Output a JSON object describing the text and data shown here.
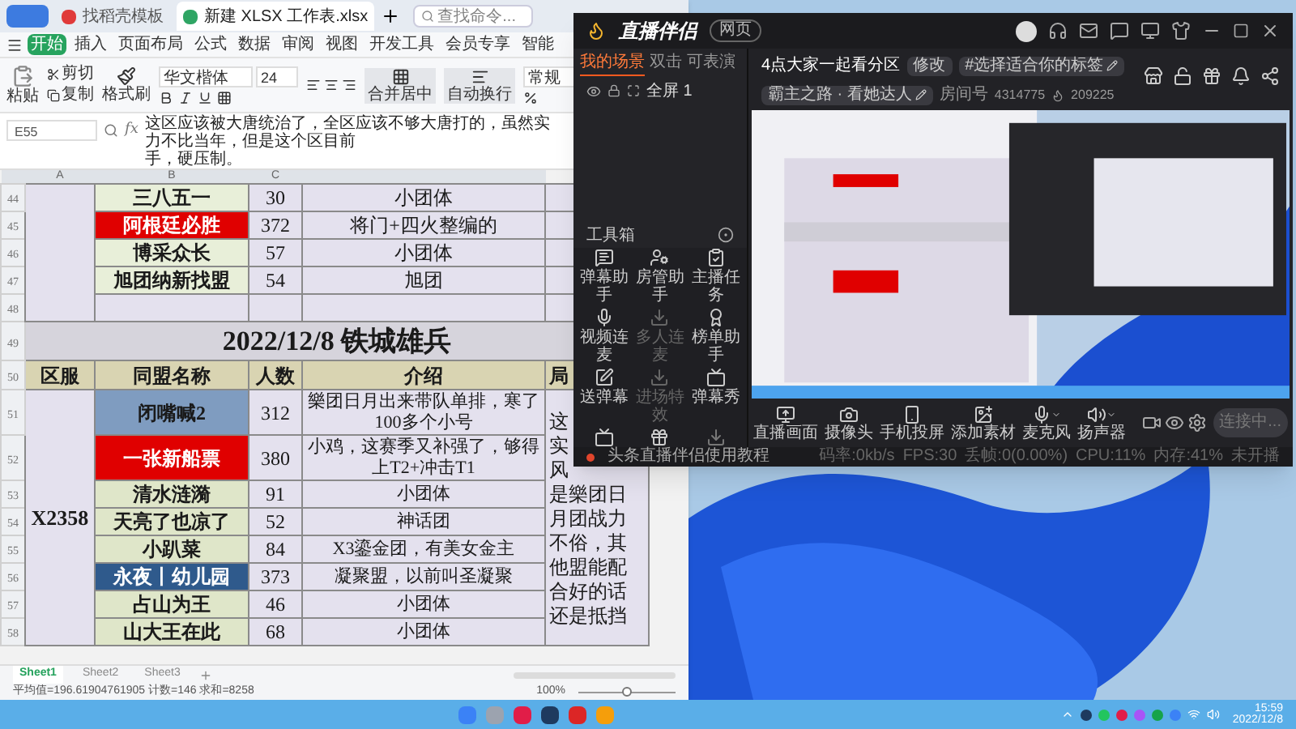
{
  "spreadsheet": {
    "tabs": [
      {
        "label": "找稻壳模板",
        "selected": false
      },
      {
        "label": "新建 XLSX 工作表.xlsx",
        "selected": true
      }
    ],
    "search": {
      "placeholder": "查找命令..."
    },
    "menu": [
      {
        "label": "开始",
        "selected": true
      },
      {
        "label": "插入",
        "selected": false
      },
      {
        "label": "页面布局",
        "selected": false
      },
      {
        "label": "公式",
        "selected": false
      },
      {
        "label": "数据",
        "selected": false
      },
      {
        "label": "审阅",
        "selected": false
      },
      {
        "label": "视图",
        "selected": false
      },
      {
        "label": "开发工具",
        "selected": false
      },
      {
        "label": "会员专享",
        "selected": false
      },
      {
        "label": "智能",
        "selected": false
      }
    ],
    "toolbar": {
      "paste": "粘贴",
      "cut": "剪切",
      "copy": "复制",
      "format_painter": "格式刷",
      "font": "华文楷体",
      "size": "24",
      "merge": "合并居中",
      "wrap": "自动换行",
      "number_format": "常规"
    },
    "cell_ref": "E55",
    "function_label": "fx",
    "formula_lines": [
      "这区应该被大唐统治了，全区应该不够大唐打的，虽然实力不比当年，但是这个区目前",
      "手，硬压制。"
    ],
    "column_headers": [
      "A",
      "B",
      "C"
    ],
    "top_rows": [
      {
        "row": "44",
        "name": "三八五一",
        "color": "#e8efd9",
        "count": "30",
        "intro": "小团体"
      },
      {
        "row": "45",
        "name": "阿根廷必胜",
        "color": "#e00000",
        "count": "372",
        "intro": "将门+四火整编的"
      },
      {
        "row": "46",
        "name": "博采众长",
        "color": "#e8efd9",
        "count": "57",
        "intro": "小团体"
      },
      {
        "row": "47",
        "name": "旭团纳新找盟",
        "color": "#e8efd9",
        "count": "54",
        "intro": "旭团"
      }
    ],
    "blank_row": "48",
    "title_row": {
      "row": "49",
      "title": "2022/12/8 铁城雄兵"
    },
    "header_row": {
      "row": "50",
      "cells": [
        "区服",
        "同盟名称",
        "人数",
        "介绍",
        "局"
      ]
    },
    "group": {
      "server": "X2358",
      "note_lines": [
        "这",
        "实",
        "风",
        "是樂团日",
        "月团战力",
        "不俗，其",
        "他盟能配",
        "合好的话",
        "还是抵挡"
      ],
      "rows": [
        {
          "row": "51",
          "name": "闭嘴喊2",
          "color": "#7f9cc0",
          "count": "312",
          "intro": "樂团日月出来带队单排，寒了100多个小号"
        },
        {
          "row": "52",
          "name": "一张新船票",
          "color": "#e00000",
          "count": "380",
          "intro": "小鸡，这赛季又补强了，够得上T2+冲击T1"
        },
        {
          "row": "53",
          "name": "清水涟漪",
          "color": "#dfe6c9",
          "count": "91",
          "intro": "小团体"
        },
        {
          "row": "54",
          "name": "天亮了也凉了",
          "color": "#dfe6c9",
          "count": "52",
          "intro": "神话团"
        },
        {
          "row": "55",
          "name": "小趴菜",
          "color": "#dfe6c9",
          "count": "84",
          "intro": "X3鎏金团，有美女金主"
        },
        {
          "row": "56",
          "name": "永夜丨幼儿园",
          "color": "#2f5a8c",
          "count": "373",
          "intro": "凝聚盟，以前叫圣凝聚"
        },
        {
          "row": "57",
          "name": "占山为王",
          "color": "#dfe6c9",
          "count": "46",
          "intro": "小团体"
        },
        {
          "row": "58",
          "name": "山大王在此",
          "color": "#dfe6c9",
          "count": "68",
          "intro": "小团体"
        }
      ]
    },
    "sheets": [
      {
        "label": "Sheet1",
        "selected": true
      },
      {
        "label": "Sheet2",
        "selected": false
      },
      {
        "label": "Sheet3",
        "selected": false
      }
    ],
    "status": "平均值=196.61904761905 计数=146 求和=8258",
    "zoom": {
      "reading": "100%",
      "level": 0.5
    }
  },
  "streamer": {
    "logo": "直播伴侣",
    "web_pill": "网页",
    "tabs": [
      {
        "label": "我的场景",
        "selected": true
      },
      {
        "label": "双击",
        "selected": false
      },
      {
        "label": "可表演",
        "selected": false
      }
    ],
    "scene": "全屏 1",
    "toolbox": "工具箱",
    "tools": [
      {
        "label": "弹幕助手",
        "disabled": false
      },
      {
        "label": "房管助手",
        "disabled": false
      },
      {
        "label": "主播任务",
        "disabled": false
      },
      {
        "label": "视频连麦",
        "disabled": false
      },
      {
        "label": "多人连麦",
        "disabled": true
      },
      {
        "label": "榜单助手",
        "disabled": false
      },
      {
        "label": "送弹幕",
        "disabled": false
      },
      {
        "label": "进场特效",
        "disabled": true
      },
      {
        "label": "弹幕秀",
        "disabled": false
      }
    ],
    "title": "4点大家一起看分区",
    "edit_tag": "修改",
    "topic": "#选择适合你的标签",
    "category": "霸主之路 · 看她达人",
    "room_label": "房间号",
    "room": "4314775",
    "viewers": "209225",
    "controls": [
      {
        "label": "直播画面",
        "menu": false
      },
      {
        "label": "摄像头",
        "menu": false
      },
      {
        "label": "手机投屏",
        "menu": false
      },
      {
        "label": "添加素材",
        "menu": false
      },
      {
        "label": "麦克风",
        "menu": true
      },
      {
        "label": "扬声器",
        "menu": true
      }
    ],
    "go_button": {
      "label": "连接中...",
      "disabled": true
    },
    "tutorial": "头条直播伴侣使用教程",
    "stats": [
      "码率:0kb/s",
      "FPS:30",
      "丢帧:0(0.00%)",
      "CPU:11%",
      "内存:41%",
      "未开播"
    ]
  },
  "taskbar": {
    "time": "15:59",
    "date": "2022/12/8"
  }
}
